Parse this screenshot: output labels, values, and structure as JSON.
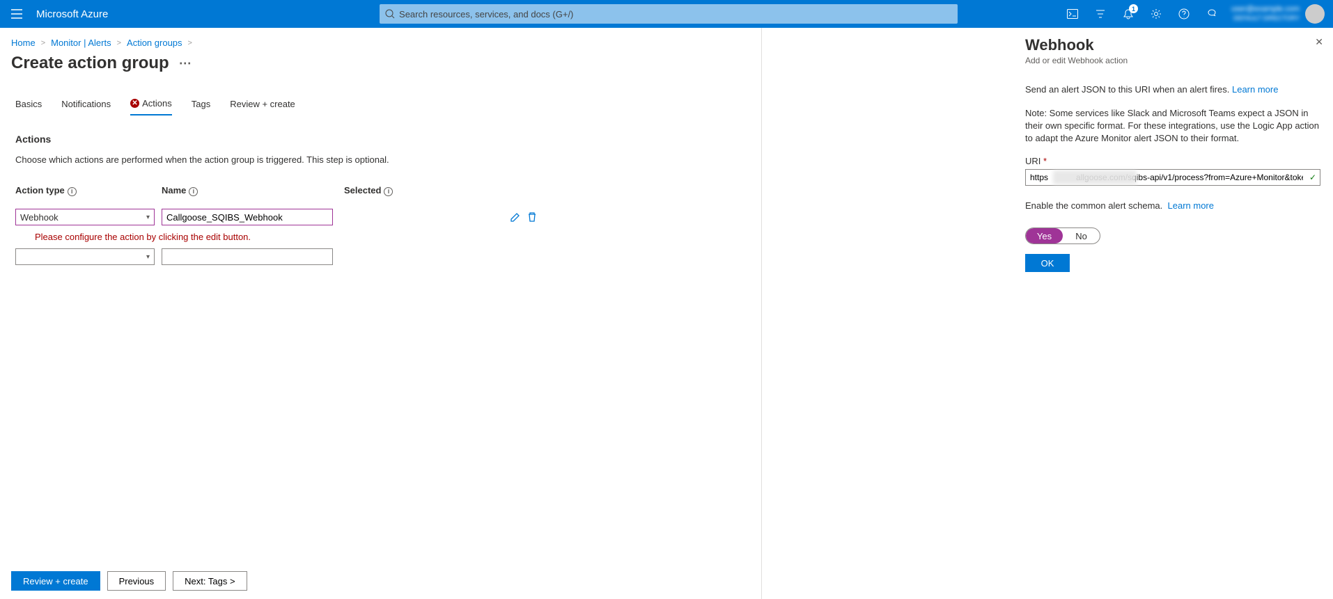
{
  "topbar": {
    "brand": "Microsoft Azure",
    "search_placeholder": "Search resources, services, and docs (G+/)",
    "notif_count": "1",
    "account_line1": "user@example.com",
    "account_line2": "DEFAULT DIRECTORY"
  },
  "breadcrumb": {
    "items": [
      "Home",
      "Monitor | Alerts",
      "Action groups"
    ]
  },
  "page": {
    "title": "Create action group",
    "section": "Actions",
    "help": "Choose which actions are performed when the action group is triggered. This step is optional.",
    "validation": "Please configure the action by clicking the edit button."
  },
  "tabs": [
    {
      "label": "Basics"
    },
    {
      "label": "Notifications"
    },
    {
      "label": "Actions"
    },
    {
      "label": "Tags"
    },
    {
      "label": "Review + create"
    }
  ],
  "table": {
    "col_type": "Action type",
    "col_name": "Name",
    "col_selected": "Selected",
    "rows": [
      {
        "type": "Webhook",
        "name": "Callgoose_SQIBS_Webhook"
      },
      {
        "type": "",
        "name": ""
      }
    ]
  },
  "footer": {
    "review": "Review + create",
    "previous": "Previous",
    "next": "Next: Tags >"
  },
  "panel": {
    "title": "Webhook",
    "subtitle": "Add or edit Webhook action",
    "desc1": "Send an alert JSON to this URI when an alert fires.",
    "learn": "Learn more",
    "desc2": "Note: Some services like Slack and Microsoft Teams expect a JSON in their own specific format. For these integrations, use the Logic App action to adapt the Azure Monitor alert JSON to their format.",
    "uri_label": "URI",
    "uri_value": "https            allgoose.com/sqibs-api/v1/process?from=Azure+Monitor&token=d  ..",
    "schema_label": "Enable the common alert schema.",
    "yes": "Yes",
    "no": "No",
    "ok": "OK"
  }
}
